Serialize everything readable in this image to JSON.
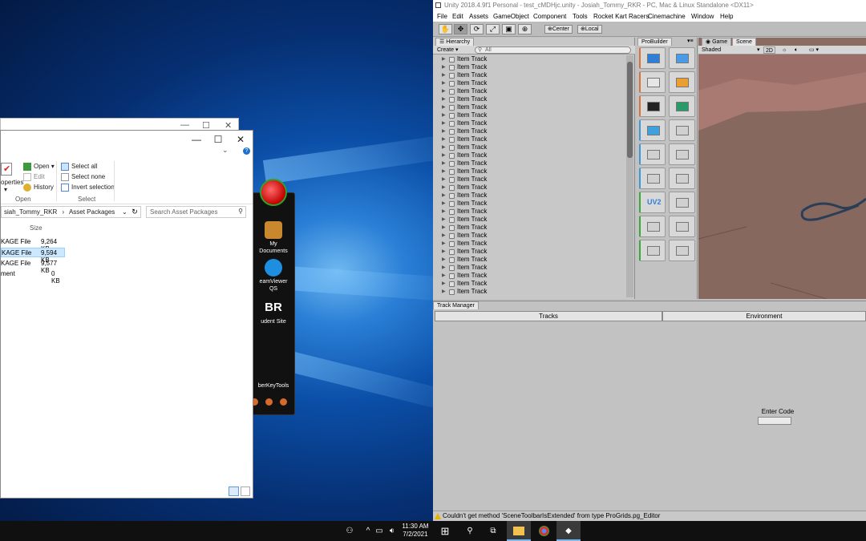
{
  "explorer": {
    "ribbon": {
      "properties_label": "operties",
      "open_label": "Open",
      "edit_label": "Edit",
      "history_label": "History",
      "select_all_label": "Select all",
      "select_none_label": "Select none",
      "invert_selection_label": "Invert selection",
      "group_open": "Open",
      "group_select": "Select"
    },
    "breadcrumb": [
      "siah_Tommy_RKR",
      "Asset Packages"
    ],
    "search_placeholder": "Search Asset Packages",
    "columns": {
      "size": "Size"
    },
    "files": [
      {
        "type": "KAGE File",
        "size": "9,264 KB",
        "selected": false
      },
      {
        "type": "KAGE File",
        "size": "9,594 KB",
        "selected": true
      },
      {
        "type": "KAGE File",
        "size": "9,577 KB",
        "selected": false
      },
      {
        "type": "ment",
        "size": "0 KB",
        "selected": false
      }
    ]
  },
  "launcher": {
    "items": [
      {
        "label": "My\nDocuments",
        "icon": "briefcase-icon"
      },
      {
        "label": "eamViewer\nQS",
        "icon": "teamviewer-icon"
      },
      {
        "label": "udent Site",
        "icon": "br-logo-icon"
      },
      {
        "label": "berKeyTools",
        "icon": ""
      }
    ],
    "br_logo_text": "BR"
  },
  "unity": {
    "title": "Unity 2018.4.9f1 Personal - test_cMDHjc.unity - Josiah_Tommy_RKR - PC, Mac & Linux Standalone <DX11>",
    "menu": [
      "File",
      "Edit",
      "Assets",
      "GameObject",
      "Component",
      "Tools",
      "Rocket Kart Racers",
      "Cinemachine",
      "Window",
      "Help"
    ],
    "toolbar": {
      "pivot_center": "Center",
      "pivot_local": "Local"
    },
    "hierarchy": {
      "tab": "Hierarchy",
      "create_label": "Create",
      "search_placeholder": "All",
      "items": [
        "Item Track",
        "Item Track",
        "Item Track",
        "Item Track",
        "Item Track",
        "Item Track",
        "Item Track",
        "Item Track",
        "Item Track",
        "Item Track",
        "Item Track",
        "Item Track",
        "Item Track",
        "Item Track",
        "Item Track",
        "Item Track",
        "Item Track",
        "Item Track",
        "Item Track",
        "Item Track",
        "Item Track",
        "Item Track",
        "Item Track",
        "Item Track",
        "Item Track",
        "Item Track",
        "Item Track",
        "Item Track",
        "Item Track",
        "Item Track"
      ]
    },
    "probuilder": {
      "tab": "ProBuilder",
      "uv_label": "UV2"
    },
    "scene": {
      "tab_game": "Game",
      "tab_scene": "Scene",
      "shading": "Shaded",
      "mode_2d": "2D"
    },
    "track_manager": {
      "tab": "Track Manager",
      "tabs": [
        "Tracks",
        "Environment"
      ],
      "enter_code_label": "Enter Code",
      "enter_code_value": ""
    },
    "status_message": "Couldn't get method 'SceneToolbarIsExtended' from type ProGrids.pg_Editor"
  },
  "taskbar": {
    "time": "11:30 AM",
    "date": "7/2/2021"
  },
  "colors": {
    "unity_panel": "#c2c2c2",
    "selection": "#cce8ff",
    "taskbar": "#101010",
    "accent_blue": "#0078d7"
  }
}
